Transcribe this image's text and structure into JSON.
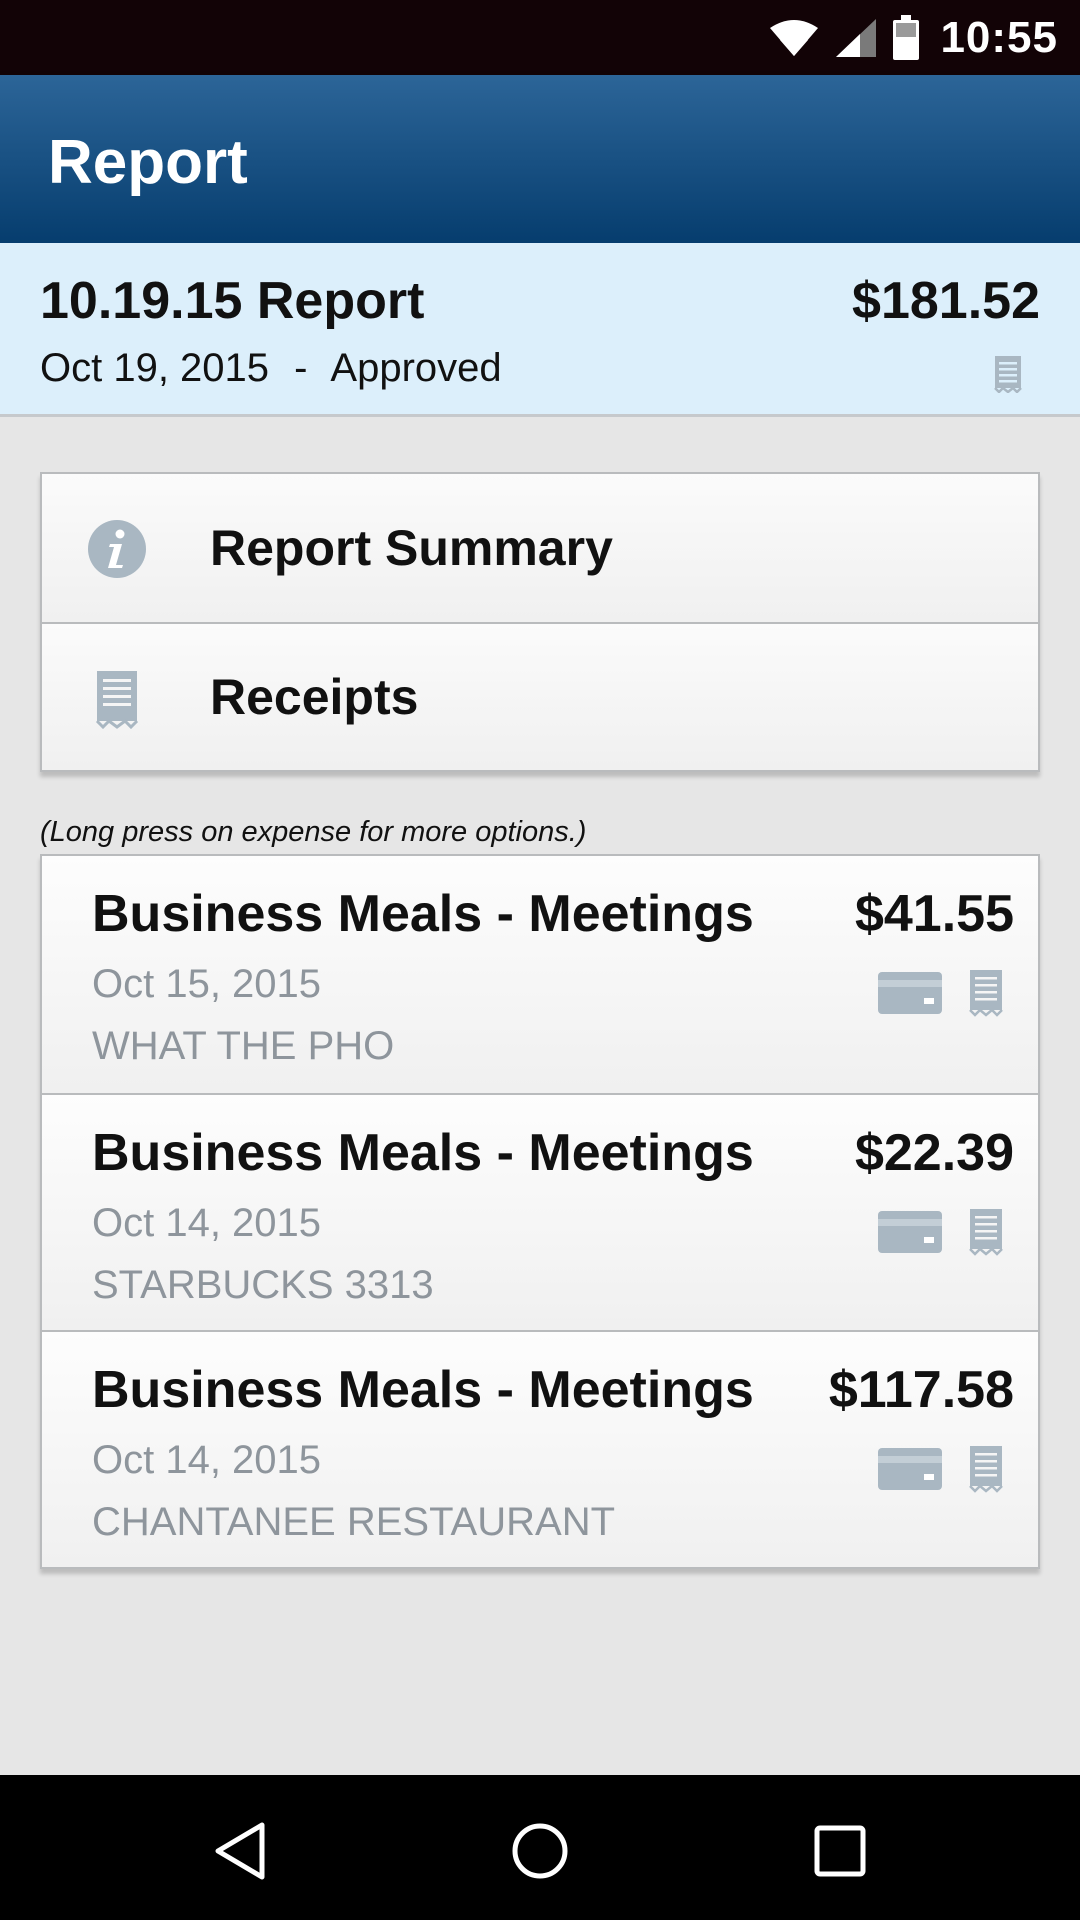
{
  "status_bar": {
    "time": "10:55",
    "icons": [
      "wifi-icon",
      "cell-signal-icon",
      "battery-icon"
    ]
  },
  "app_bar": {
    "title": "Report"
  },
  "report": {
    "name": "10.19.15 Report",
    "total": "$181.52",
    "date": "Oct 19, 2015",
    "separator": "-",
    "status": "Approved"
  },
  "menu": {
    "items": [
      {
        "label": "Report Summary",
        "icon": "info-icon"
      },
      {
        "label": "Receipts",
        "icon": "receipt-icon"
      }
    ]
  },
  "hint": "(Long press on expense for more options.)",
  "expenses": [
    {
      "type": "Business Meals - Meetings",
      "amount": "$41.55",
      "date": "Oct 15, 2015",
      "vendor": "WHAT THE PHO"
    },
    {
      "type": "Business Meals - Meetings",
      "amount": "$22.39",
      "date": "Oct 14, 2015",
      "vendor": "STARBUCKS 3313"
    },
    {
      "type": "Business Meals - Meetings",
      "amount": "$117.58",
      "date": "Oct 14, 2015",
      "vendor": "CHANTANEE RESTAURANT"
    }
  ],
  "nav": [
    "back-icon",
    "home-icon",
    "recents-icon"
  ],
  "colors": {
    "app_bar": "#1f5a8e",
    "header_bg": "#dceffb",
    "muted_text": "#8e959c",
    "icon_gray": "#a9b7c2"
  }
}
